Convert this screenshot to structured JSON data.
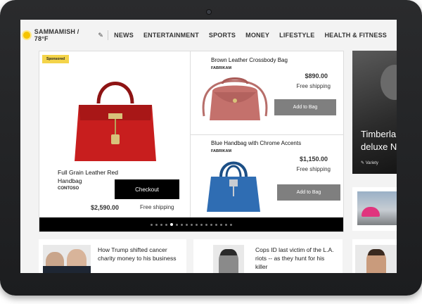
{
  "weather": {
    "location_temp": "SAMMAMISH / 78°F"
  },
  "nav": {
    "items": [
      "NEWS",
      "ENTERTAINMENT",
      "SPORTS",
      "MONEY",
      "LIFESTYLE",
      "HEALTH & FITNESS"
    ]
  },
  "ad": {
    "sponsored_label": "Sponsored",
    "featured": {
      "title": "Full Grain Leather Red Handbag",
      "brand": "CONTOSO",
      "checkout_label": "Checkout",
      "price": "$2,590.00",
      "shipping": "Free shipping"
    },
    "products": [
      {
        "title": "Brown Leather Crossbody Bag",
        "brand": "FABRIKAM",
        "price": "$890.00",
        "shipping": "Free shipping",
        "button": "Add to Bag"
      },
      {
        "title": "Blue Handbag with Chrome Accents",
        "brand": "FABRIKAM",
        "price": "$1,150.00",
        "shipping": "Free shipping",
        "button": "Add to Bag"
      }
    ],
    "carousel": {
      "total": 17,
      "active_index": 4
    }
  },
  "right_feature": {
    "title": "Timberla deluxe N",
    "source": "Variety"
  },
  "news": [
    {
      "headline": "How Trump shifted cancer charity money to his business"
    },
    {
      "headline": "Cops ID last victim of the L.A. riots -- as they hunt for his killer"
    }
  ],
  "colors": {
    "sponsored": "#f4d44a",
    "checkout_bg": "#000000",
    "add_to_bag_bg": "#7f7f7f",
    "sun": "#f5c400"
  }
}
